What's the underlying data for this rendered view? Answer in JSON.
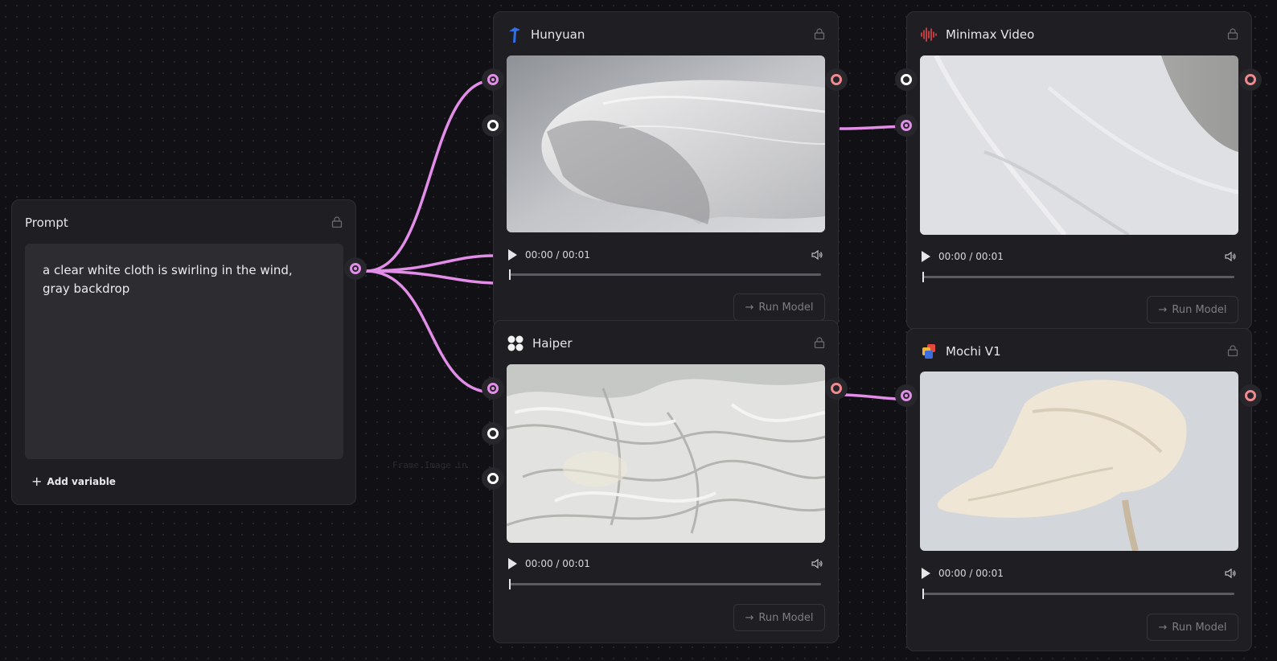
{
  "prompt_node": {
    "title": "Prompt",
    "text": "a clear white cloth is swirling in the wind, gray backdrop",
    "add_variable_label": "Add variable"
  },
  "ghost_label": "Frame Image in",
  "models": [
    {
      "key": "hunyuan",
      "title": "Hunyuan",
      "time": "00:00 / 00:01",
      "run_label": "Run Model"
    },
    {
      "key": "minimax",
      "title": "Minimax Video",
      "time": "00:00 / 00:01",
      "run_label": "Run Model"
    },
    {
      "key": "haiper",
      "title": "Haiper",
      "time": "00:00 / 00:01",
      "run_label": "Run Model"
    },
    {
      "key": "mochi",
      "title": "Mochi V1",
      "time": "00:00 / 00:01",
      "run_label": "Run Model"
    }
  ],
  "colors": {
    "wire": "#e28ee8",
    "port_active": "#e28ee8",
    "port_output": "#f08a8f",
    "background": "#111014",
    "node_bg": "#1f1f23"
  },
  "icons": {
    "hunyuan": "hunyuan-logo-icon",
    "minimax": "minimax-waveform-icon",
    "haiper": "haiper-logo-icon",
    "mochi": "mochi-logo-icon",
    "lock": "lock-icon",
    "play": "play-icon",
    "volume": "volume-icon",
    "arrow": "arrow-right-icon",
    "plus": "plus-icon"
  }
}
